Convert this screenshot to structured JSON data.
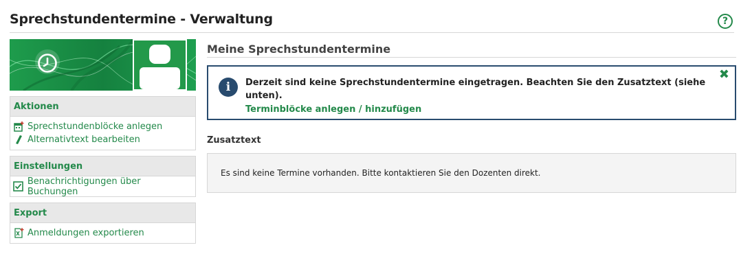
{
  "header": {
    "title": "Sprechstundentermine - Verwaltung",
    "help_icon": "question-circle-icon",
    "help_label": "?"
  },
  "banner": {
    "left_icon": "clock-icon",
    "right_icon": "user-silhouette-icon"
  },
  "sidebar": {
    "actions": {
      "heading": "Aktionen",
      "items": [
        {
          "label": "Sprechstundenblöcke anlegen",
          "icon": "calendar-add-icon"
        },
        {
          "label": "Alternativtext bearbeiten",
          "icon": "pencil-icon"
        }
      ]
    },
    "settings": {
      "heading": "Einstellungen",
      "items": [
        {
          "label": "Benachrichtigungen über Buchungen",
          "icon": "checkbox-checked-icon",
          "checked": true
        }
      ]
    },
    "export": {
      "heading": "Export",
      "items": [
        {
          "label": "Anmeldungen exportieren",
          "icon": "export-file-icon"
        }
      ]
    }
  },
  "main": {
    "title": "Meine Sprechstundentermine",
    "info": {
      "icon": "info-icon",
      "icon_label": "i",
      "message": "Derzeit sind keine Sprechstundentermine eingetragen. Beachten Sie den Zusatztext (siehe unten).",
      "link": "Terminblöcke anlegen / hinzufügen",
      "close_icon": "close-icon",
      "close_label": "✖"
    },
    "extra_text": {
      "heading": "Zusatztext",
      "body": "Es sind keine Termine vorhanden. Bitte kontaktieren Sie den Dozenten direkt."
    }
  },
  "colors": {
    "accent": "#23894a",
    "info_border": "#284b6e",
    "box_head_bg": "#e8e8e8",
    "note_bg": "#f4f4f4"
  }
}
